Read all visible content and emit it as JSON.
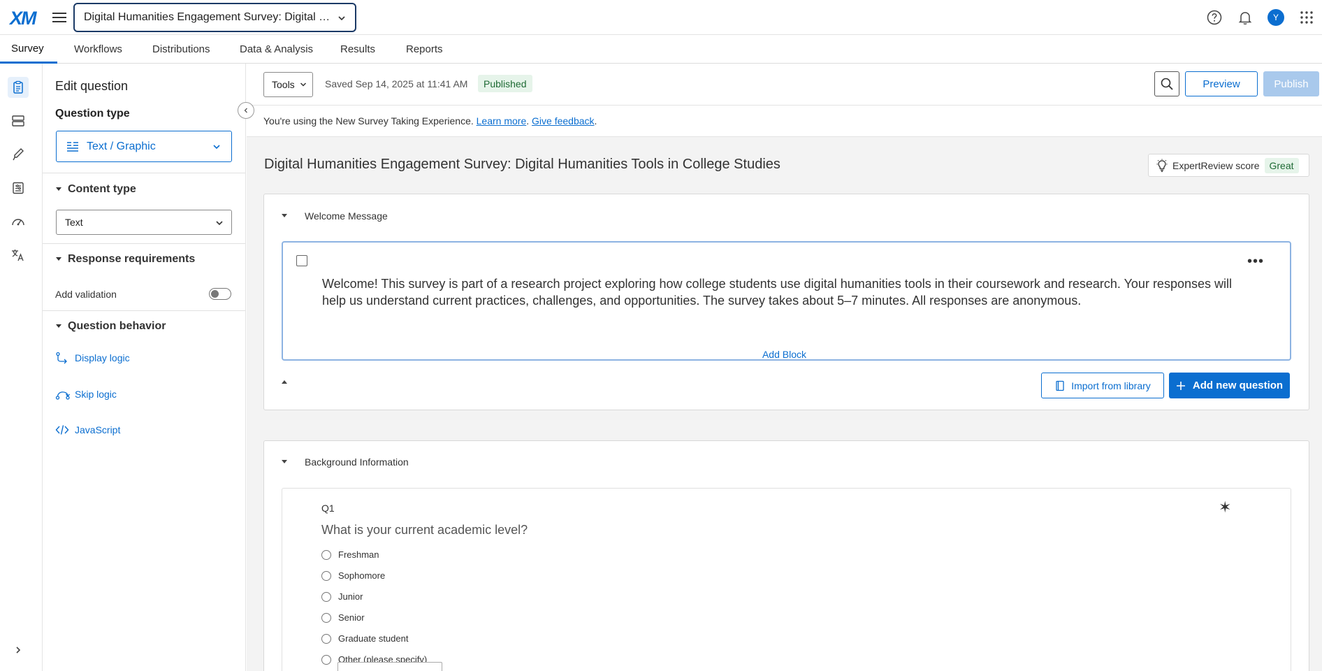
{
  "topbar": {
    "logo": "XM",
    "project_title": "Digital Humanities Engagement Survey: Digital Humanities Tools in College Studies",
    "avatar_initial": "Y"
  },
  "tabs": [
    "Survey",
    "Workflows",
    "Distributions",
    "Data & Analysis",
    "Results",
    "Reports"
  ],
  "edit_panel": {
    "title": "Edit question",
    "question_type_label": "Question type",
    "question_type_value": "Text / Graphic",
    "content_type_label": "Content type",
    "content_type_value": "Text",
    "response_requirements_label": "Response requirements",
    "add_validation_label": "Add validation",
    "add_validation_on": false,
    "question_behavior_label": "Question behavior",
    "display_logic": "Display logic",
    "skip_logic": "Skip logic",
    "javascript": "JavaScript"
  },
  "toolbar": {
    "tools_label": "Tools",
    "saved_text": "Saved Sep 14, 2025 at 11:41 AM",
    "status_badge": "Published",
    "preview_label": "Preview",
    "publish_label": "Publish"
  },
  "notice": {
    "text": "You're using the New Survey Taking Experience.",
    "learn_more": "Learn more",
    "sep": ".",
    "give_feedback": "Give feedback",
    "end": "."
  },
  "survey": {
    "title": "Digital Humanities Engagement Survey: Digital Humanities Tools in College Studies",
    "expert_review_label": "ExpertReview score",
    "expert_review_value": "Great"
  },
  "block1": {
    "name": "Welcome Message",
    "question_text": "Welcome! This survey is part of a research project exploring how college students use digital humanities tools in their coursework and research. Your responses will help us understand current practices, challenges, and opportunities. The survey takes about 5–7 minutes. All responses are anonymous.",
    "import_label": "Import from library",
    "add_question_label": "Add new question"
  },
  "add_block_label": "Add Block",
  "block2": {
    "name": "Background Information",
    "q_label": "Q1",
    "q_text": "What is your current academic level?",
    "choices": [
      "Freshman",
      "Sophomore",
      "Junior",
      "Senior",
      "Graduate student",
      "Other (please specify)"
    ]
  },
  "colors": {
    "accent": "#0b6ed0",
    "published_bg": "#e6f4ea",
    "published_text": "#1e6a34",
    "publish_disabled": "#a9c9ec"
  },
  "icons": {
    "rail": [
      "survey-icon",
      "blocks-icon",
      "look-and-feel-icon",
      "survey-options-icon",
      "dashboard-icon",
      "translate-icon",
      "expand-rail-icon"
    ],
    "top": [
      "help-icon",
      "notifications-icon",
      "apps-grid-icon"
    ]
  }
}
